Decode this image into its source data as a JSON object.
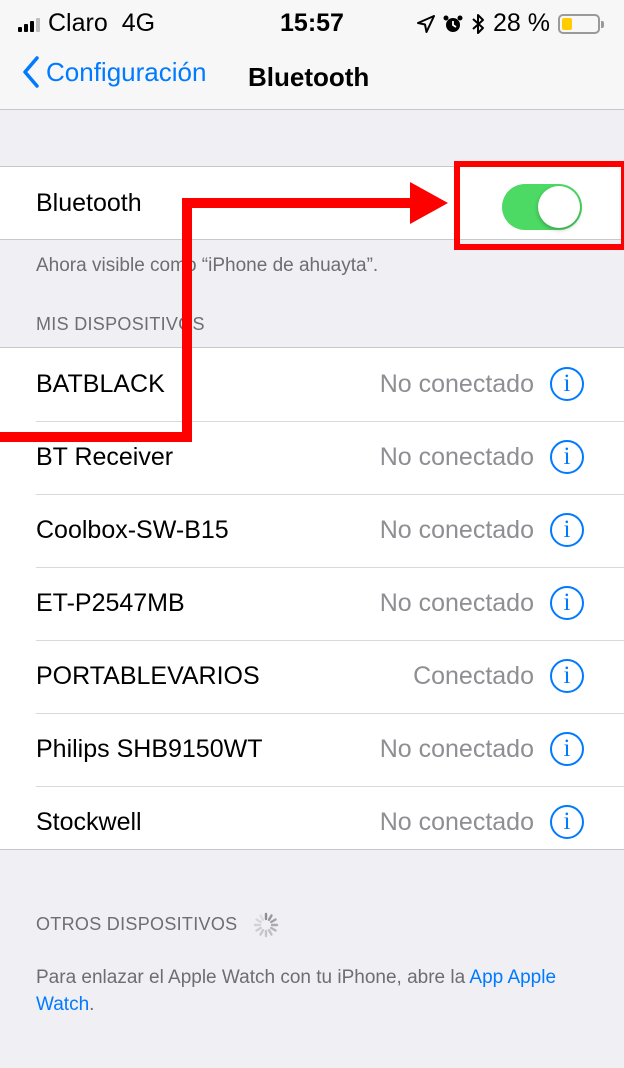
{
  "status_bar": {
    "carrier": "Claro",
    "network": "4G",
    "time": "15:57",
    "battery_percent": "28 %",
    "battery_level": 0.28,
    "icons": [
      "signal-icon",
      "location-icon",
      "alarm-icon",
      "bluetooth-icon",
      "battery-icon"
    ]
  },
  "nav": {
    "back_label": "Configuración",
    "title": "Bluetooth"
  },
  "bluetooth": {
    "label": "Bluetooth",
    "enabled": true,
    "visibility_note": "Ahora visible como “iPhone de ahuayta”."
  },
  "my_devices": {
    "header": "MIS DISPOSITIVOS",
    "items": [
      {
        "name": "BATBLACK",
        "status": "No conectado"
      },
      {
        "name": "BT Receiver",
        "status": "No conectado"
      },
      {
        "name": "Coolbox-SW-B15",
        "status": "No conectado"
      },
      {
        "name": "ET-P2547MB",
        "status": "No conectado"
      },
      {
        "name": "PORTABLEVARIOS",
        "status": "Conectado"
      },
      {
        "name": "Philips SHB9150WT",
        "status": "No conectado"
      },
      {
        "name": "Stockwell",
        "status": "No conectado"
      }
    ],
    "info_glyph": "i"
  },
  "other_devices": {
    "header": "OTROS DISPOSITIVOS",
    "note_prefix": "Para enlazar el Apple Watch con tu iPhone, abre la ",
    "note_link": "App Apple Watch",
    "note_suffix": "."
  },
  "colors": {
    "accent": "#007aff",
    "toggle_on": "#4cd964",
    "annotation": "#ff0000",
    "battery": "#ffcc00"
  }
}
